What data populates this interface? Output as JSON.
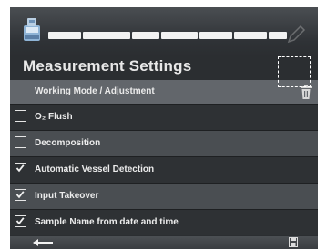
{
  "screen": {
    "title": "Measurement Settings"
  },
  "header": {
    "label": "Working Mode / Adjustment"
  },
  "settings": [
    {
      "label": "O₂ Flush",
      "checked": false
    },
    {
      "label": "Decomposition",
      "checked": false
    },
    {
      "label": "Automatic Vessel Detection",
      "checked": true
    },
    {
      "label": "Input Takeover",
      "checked": true
    },
    {
      "label": "Sample Name from date and time",
      "checked": true
    }
  ],
  "icons": {
    "app": "instrument-icon",
    "edit": "pen-icon",
    "delete": "trash-icon",
    "back": "back-arrow-icon",
    "save": "save-icon"
  },
  "colors": {
    "background": "#2b2e31",
    "header_row": "#62666b",
    "alternate_row": "#4a4e52",
    "text": "#ececec"
  }
}
